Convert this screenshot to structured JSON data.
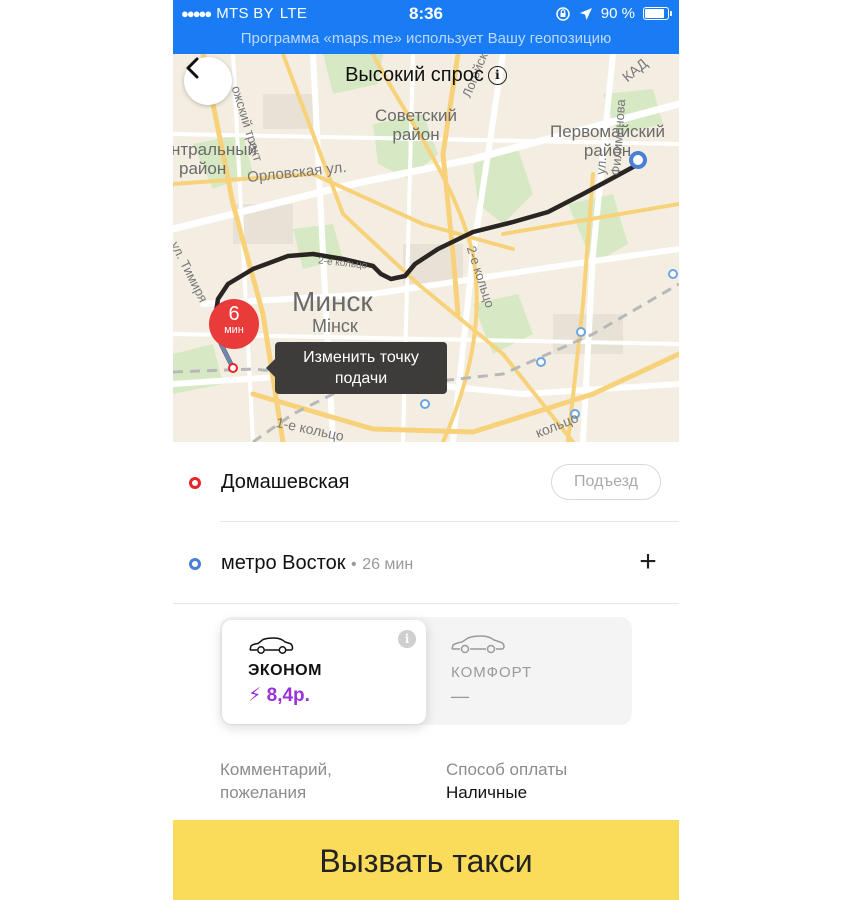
{
  "status_bar": {
    "signal": "●●●●●",
    "carrier": "MTS BY",
    "network": "LTE",
    "time": "8:36",
    "battery": "90 %",
    "geo_banner": "Программа «maps.me» использует Вашу геопозицию"
  },
  "map": {
    "title": "Высокий спрос",
    "info_glyph": "i",
    "labels": {
      "sovetsky": [
        "Советский",
        "район"
      ],
      "pervomaisky": [
        "Первомайский",
        "район"
      ],
      "centralny": [
        "нтральный",
        "район"
      ],
      "orlovskaya": "Орловская ул.",
      "minsk": "Минск",
      "minsk_sub": "Мінск",
      "logoysky": "Логойский тр.",
      "lozhinsky": "ожский тракт",
      "koltso2": "2-е кольцо",
      "koltso2_top": "2-е кольцо",
      "filimonova": "ул. Филимонова",
      "timiryazeva": "ул. Тимиря",
      "koltso1": [
        "1-е",
        "кольцо"
      ],
      "koltso_right": "кольцо",
      "kad": "КАД"
    },
    "eta_bubble": {
      "value": "6",
      "unit": "мин"
    },
    "tooltip": [
      "Изменить точку",
      "подачи"
    ]
  },
  "pickup": {
    "address": "Домашевская",
    "entrance_button": "Подъезд"
  },
  "destination": {
    "address": "метро Восток",
    "separator": "•",
    "eta": "26 мин",
    "add_glyph": "+"
  },
  "tariffs": [
    {
      "name": "ЭКОНОМ",
      "price_glyph": "⚡",
      "price": "8,4р.",
      "info_glyph": "i"
    },
    {
      "name": "КОМФОРТ",
      "price": "—"
    }
  ],
  "options": {
    "comment": [
      "Комментарий,",
      "пожелания"
    ],
    "payment_label": "Способ оплаты",
    "payment_value": "Наличные"
  },
  "call_button": "Вызвать такси",
  "colors": {
    "status_bar": "#1a7cf5",
    "pickup_dot": "#e8242b",
    "destination_dot": "#4a7fd8",
    "eta_bubble": "#ea3b3b",
    "price": "#9a32d8",
    "call_button": "#fbdb5a",
    "route": "#2a2522"
  }
}
